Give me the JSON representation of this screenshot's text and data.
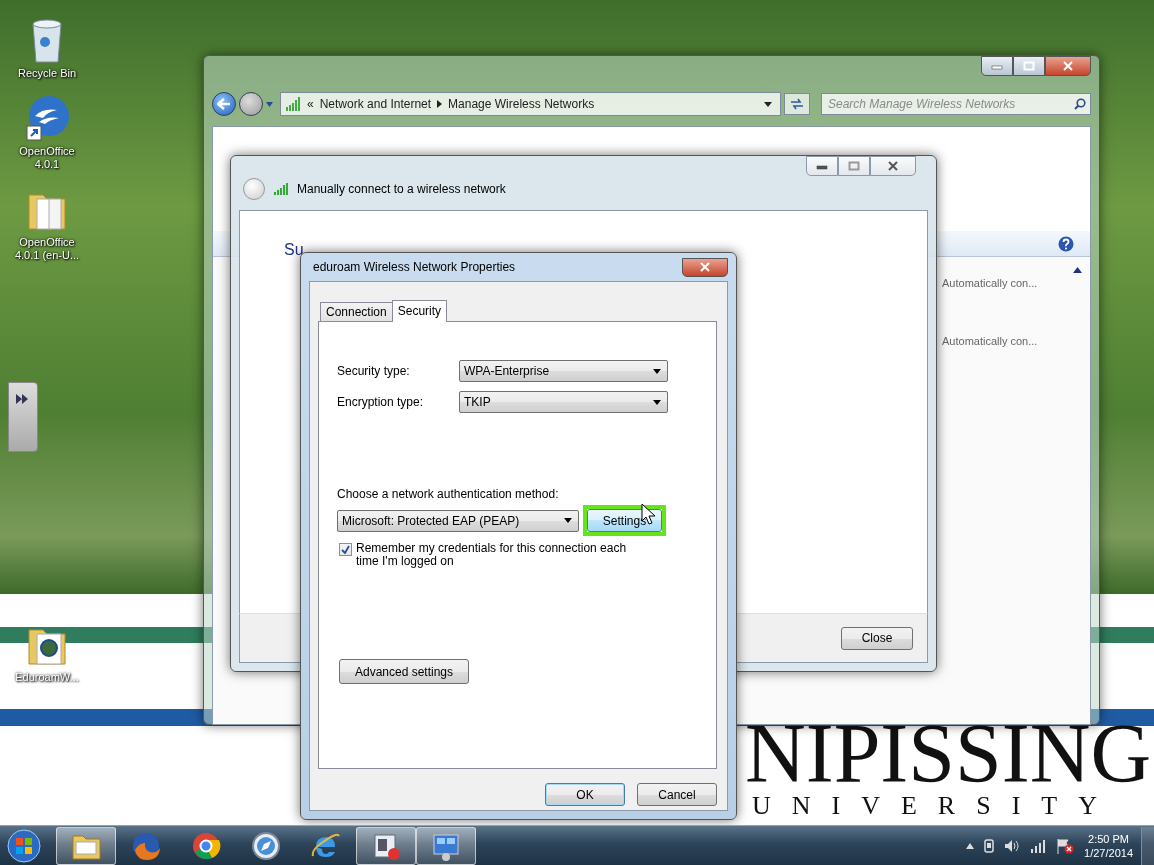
{
  "desktop": {
    "icons": [
      {
        "kind": "recycle-bin",
        "label": "Recycle Bin"
      },
      {
        "kind": "openoffice",
        "label": "OpenOffice 4.0.1"
      },
      {
        "kind": "folder",
        "label": "OpenOffice 4.0.1 (en-U..."
      },
      {
        "kind": "eduroam-folder",
        "label": "EduroamW..."
      }
    ],
    "wallpaper_logo": {
      "title": "NIPISSING",
      "subtitle": "UNIVERSITY"
    }
  },
  "explorer": {
    "address": {
      "overflow": "«",
      "crumbs": [
        "Network and Internet",
        "Manage Wireless Networks"
      ]
    },
    "search": {
      "placeholder": "Search Manage Wireless Networks"
    },
    "network_rows": [
      {
        "status": "Automatically con..."
      },
      {
        "status": "Automatically con..."
      }
    ]
  },
  "wizard": {
    "title": "Manually connect to a wireless network",
    "heading": "Su",
    "buttons": [
      "Close"
    ]
  },
  "dialog": {
    "title": "eduroam Wireless Network Properties",
    "tabs": [
      {
        "label": "Connection",
        "selected": false
      },
      {
        "label": "Security",
        "selected": true
      }
    ],
    "fields": [
      {
        "label": "Security type:",
        "value": "WPA-Enterprise"
      },
      {
        "label": "Encryption type:",
        "value": "TKIP"
      }
    ],
    "auth_label": "Choose a network authentication method:",
    "auth_method": "Microsoft: Protected EAP (PEAP)",
    "settings_button": {
      "label": "Settings",
      "highlighted": true
    },
    "remember": {
      "label": "Remember my credentials for this connection each time I'm logged on",
      "checked": true
    },
    "advanced_button": "Advanced settings",
    "buttons": [
      {
        "label": "OK",
        "default": true
      },
      {
        "label": "Cancel",
        "default": false
      }
    ]
  },
  "taskbar": {
    "apps": [
      {
        "kind": "explorer",
        "active": true
      },
      {
        "kind": "firefox",
        "active": false
      },
      {
        "kind": "chrome",
        "active": false
      },
      {
        "kind": "safari",
        "active": false
      },
      {
        "kind": "ie",
        "active": false
      },
      {
        "kind": "media",
        "active": true
      },
      {
        "kind": "control-panel",
        "active": true
      }
    ],
    "clock": {
      "time": "2:50 PM",
      "date": "1/27/2014"
    }
  }
}
